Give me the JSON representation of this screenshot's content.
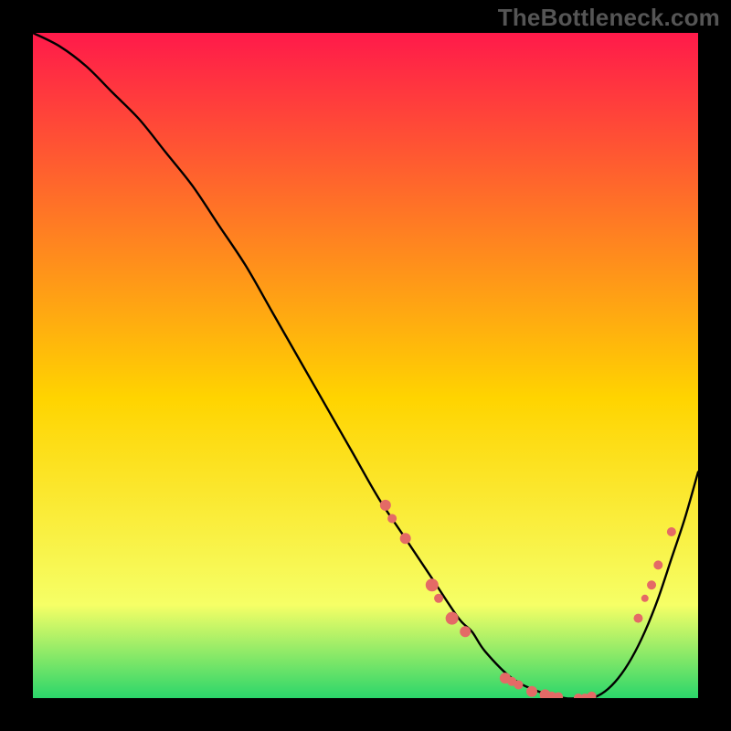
{
  "watermark": "TheBottleneck.com",
  "colors": {
    "bg_black": "#000000",
    "curve": "#000000",
    "marker": "#e46a66",
    "gradient_top": "#ff1a4a",
    "gradient_mid": "#ffd400",
    "gradient_low": "#f6ff66",
    "gradient_green": "#2bd66a"
  },
  "chart_data": {
    "type": "line",
    "title": "",
    "xlabel": "",
    "ylabel": "",
    "xlim": [
      0,
      100
    ],
    "ylim": [
      0,
      100
    ],
    "curve": {
      "x": [
        0,
        4,
        8,
        12,
        16,
        20,
        24,
        28,
        32,
        36,
        40,
        44,
        48,
        52,
        56,
        60,
        64,
        66,
        68,
        72,
        76,
        80,
        82,
        84,
        86,
        88,
        90,
        92,
        94,
        96,
        98,
        100
      ],
      "y": [
        100,
        98,
        95,
        91,
        87,
        82,
        77,
        71,
        65,
        58,
        51,
        44,
        37,
        30,
        24,
        18,
        12,
        10,
        7,
        3,
        1,
        0,
        0,
        0,
        1,
        3,
        6,
        10,
        15,
        21,
        27,
        34
      ]
    },
    "markers": [
      {
        "x": 53,
        "y": 29,
        "r": 6
      },
      {
        "x": 54,
        "y": 27,
        "r": 5
      },
      {
        "x": 56,
        "y": 24,
        "r": 6
      },
      {
        "x": 60,
        "y": 17,
        "r": 7
      },
      {
        "x": 61,
        "y": 15,
        "r": 5
      },
      {
        "x": 63,
        "y": 12,
        "r": 7
      },
      {
        "x": 65,
        "y": 10,
        "r": 6
      },
      {
        "x": 71,
        "y": 3,
        "r": 6
      },
      {
        "x": 72,
        "y": 2.5,
        "r": 5
      },
      {
        "x": 73,
        "y": 2,
        "r": 5
      },
      {
        "x": 75,
        "y": 1,
        "r": 6
      },
      {
        "x": 77,
        "y": 0.5,
        "r": 6
      },
      {
        "x": 78,
        "y": 0.3,
        "r": 5
      },
      {
        "x": 79,
        "y": 0.2,
        "r": 5
      },
      {
        "x": 82,
        "y": 0,
        "r": 5
      },
      {
        "x": 83,
        "y": 0,
        "r": 5
      },
      {
        "x": 84,
        "y": 0.3,
        "r": 5
      },
      {
        "x": 91,
        "y": 12,
        "r": 5
      },
      {
        "x": 92,
        "y": 15,
        "r": 4
      },
      {
        "x": 93,
        "y": 17,
        "r": 5
      },
      {
        "x": 94,
        "y": 20,
        "r": 5
      },
      {
        "x": 96,
        "y": 25,
        "r": 5
      }
    ]
  }
}
